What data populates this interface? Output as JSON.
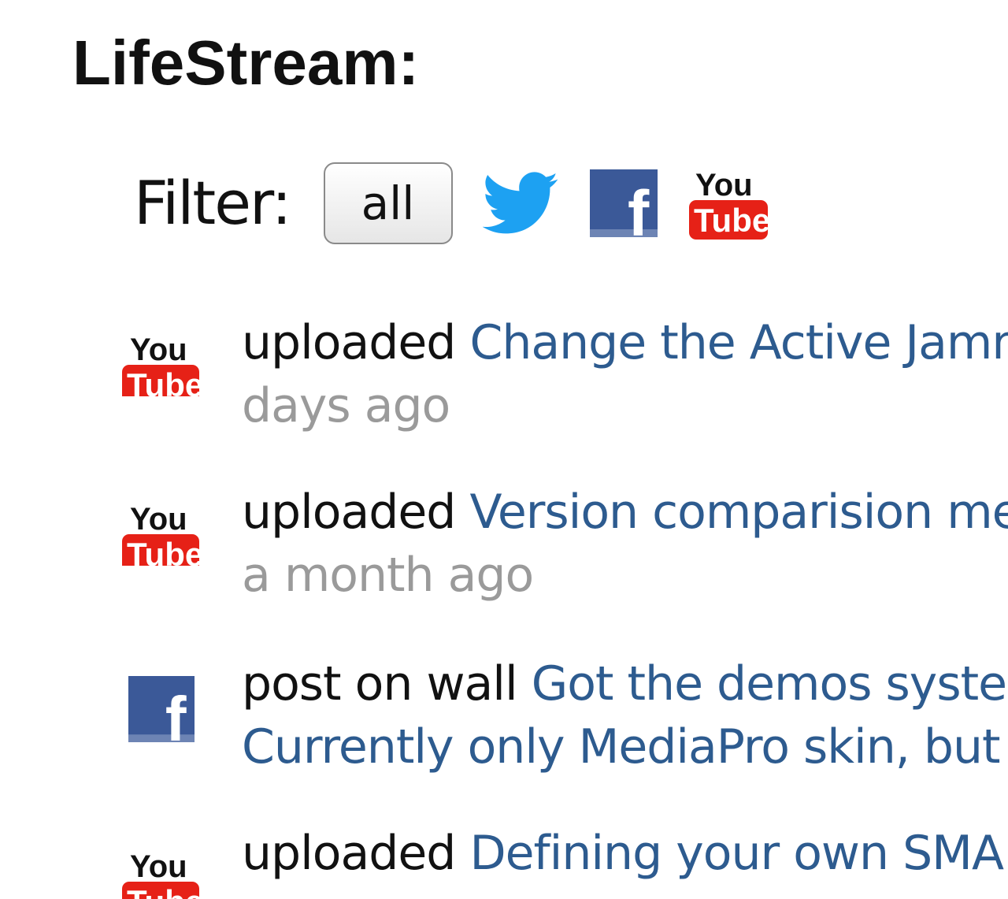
{
  "title": "LifeStream:",
  "filter": {
    "label": "Filter:",
    "all_label": "all",
    "twitter_icon": "twitter-bird-icon",
    "facebook_icon": "facebook-f-icon",
    "youtube_icon": "youtube-logo-icon"
  },
  "youtube_logo": {
    "you": "You",
    "tube": "Tube"
  },
  "facebook_logo": {
    "letter": "f"
  },
  "colors": {
    "twitter": "#1da1f2",
    "facebook": "#3b5998",
    "youtube_red": "#e62117",
    "link": "#2d5b8f",
    "time": "#9a9a9a"
  },
  "items": [
    {
      "source": "youtube",
      "verb": "uploaded",
      "link": "Change the Active Jamm",
      "time": "days ago"
    },
    {
      "source": "youtube",
      "verb": "uploaded",
      "link": "Version comparision me",
      "time": "a month ago"
    },
    {
      "source": "facebook",
      "verb": "post on wall",
      "link": "Got the demos syste",
      "second_line": "Currently only MediaPro skin, but"
    },
    {
      "source": "youtube",
      "verb": "uploaded",
      "link": "Defining your own SMA"
    }
  ]
}
